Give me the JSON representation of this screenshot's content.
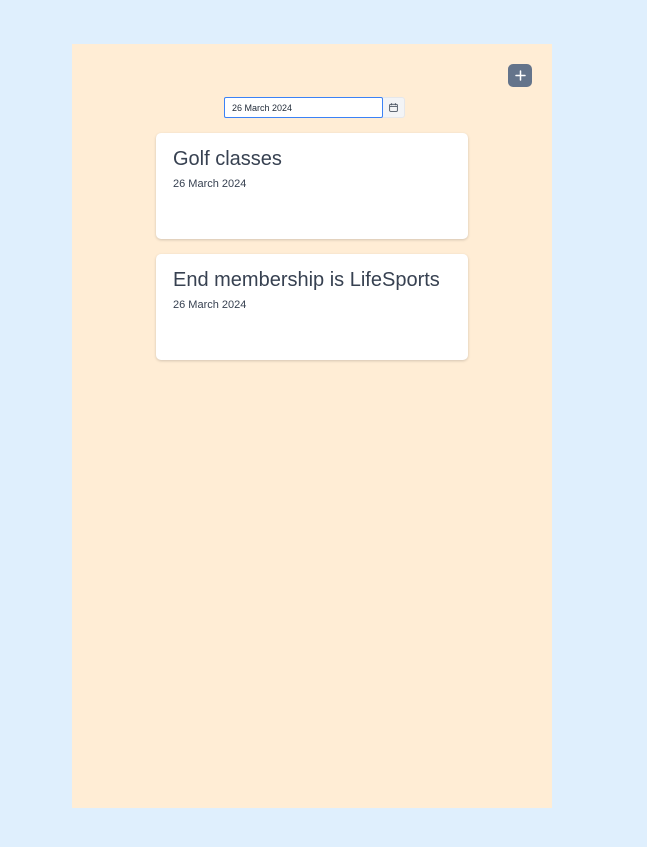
{
  "toolbar": {
    "add_icon": "plus-icon",
    "date_value": "26 March 2024",
    "calendar_icon": "calendar-icon"
  },
  "tasks": [
    {
      "title": "Golf classes",
      "date": "26 March 2024"
    },
    {
      "title": "End membership is LifeSports",
      "date": "26 March 2024"
    }
  ],
  "colors": {
    "page_background": "#dfeffd",
    "panel_background": "#ffedd5",
    "add_button": "#64748b",
    "input_border": "#3b82f6",
    "card_background": "#ffffff",
    "text": "#374151"
  }
}
